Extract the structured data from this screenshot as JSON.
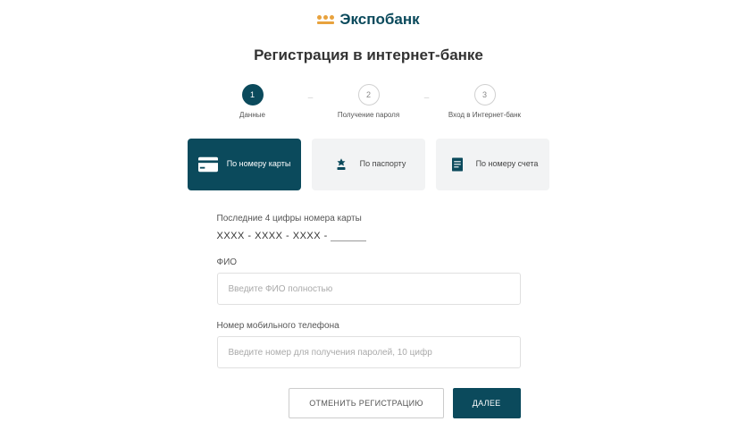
{
  "brand": {
    "name": "Экспобанк"
  },
  "page": {
    "title": "Регистрация в интернет-банке"
  },
  "stepper": {
    "steps": [
      {
        "num": "1",
        "label": "Данные",
        "active": true
      },
      {
        "num": "2",
        "label": "Получение пароля",
        "active": false
      },
      {
        "num": "3",
        "label": "Вход в Интернет-банк",
        "active": false
      }
    ]
  },
  "tabs": {
    "card": "По номеру карты",
    "passport": "По паспорту",
    "account": "По номеру счета"
  },
  "fields": {
    "card_label": "Последние 4 цифры номера карты",
    "card_mask_prefix": "XXXX - XXXX - XXXX -",
    "fio_label": "ФИО",
    "fio_placeholder": "Введите ФИО полностью",
    "phone_label": "Номер мобильного телефона",
    "phone_placeholder": "Введите номер для получения паролей, 10 цифр"
  },
  "actions": {
    "cancel": "ОТМЕНИТЬ РЕГИСТРАЦИЮ",
    "next": "ДАЛЕЕ"
  },
  "colors": {
    "primary": "#0b4a5c",
    "accent": "#e8a23d"
  }
}
